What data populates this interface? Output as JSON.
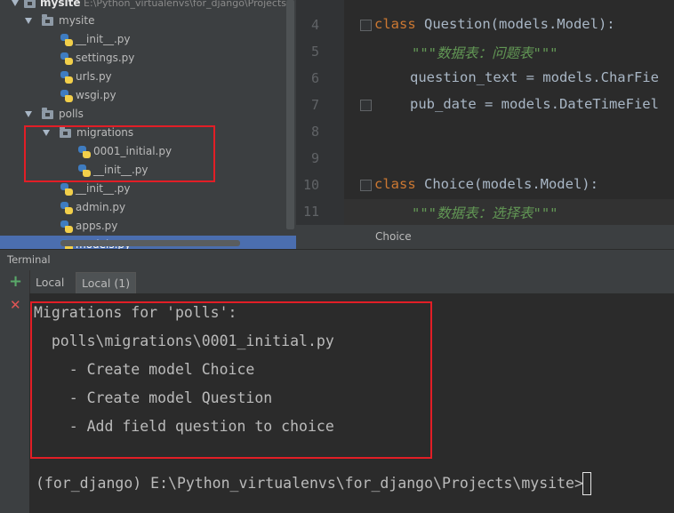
{
  "project_tree": {
    "items": [
      {
        "label": "mysite",
        "extra": "E:\\Python_virtualenvs\\for_django\\Projects",
        "kind": "folder",
        "expanded": true
      },
      {
        "label": "mysite",
        "kind": "folder",
        "expanded": true
      },
      {
        "label": "__init__.py",
        "kind": "file"
      },
      {
        "label": "settings.py",
        "kind": "file"
      },
      {
        "label": "urls.py",
        "kind": "file"
      },
      {
        "label": "wsgi.py",
        "kind": "file"
      },
      {
        "label": "polls",
        "kind": "folder",
        "expanded": true
      },
      {
        "label": "migrations",
        "kind": "folder",
        "expanded": true
      },
      {
        "label": "0001_initial.py",
        "kind": "file"
      },
      {
        "label": "__init__.py",
        "kind": "file"
      },
      {
        "label": "__init__.py",
        "kind": "file"
      },
      {
        "label": "admin.py",
        "kind": "file"
      },
      {
        "label": "apps.py",
        "kind": "file"
      },
      {
        "label": "models.py",
        "kind": "file",
        "selected": true
      }
    ]
  },
  "editor": {
    "lines": [
      {
        "num": "4",
        "kw": "class",
        "rest": " Question(models.Model):"
      },
      {
        "num": "5",
        "doc": "\"\"\"数据表：问题表\"\"\""
      },
      {
        "num": "6",
        "code": "question_text = models.CharFie"
      },
      {
        "num": "7",
        "code": "pub_date = models.DateTimeFiel"
      },
      {
        "num": "8"
      },
      {
        "num": "9"
      },
      {
        "num": "10",
        "kw": "class",
        "rest": " Choice(models.Model):"
      },
      {
        "num": "11",
        "doc": "\"\"\"数据表：选择表\"\"\""
      }
    ],
    "breadcrumb": "Choice"
  },
  "terminal": {
    "title": "Terminal",
    "tabs": [
      "Local",
      "Local (1)"
    ],
    "add_icon": "+",
    "close_icon": "✕",
    "output": [
      "Migrations for 'polls':",
      "  polls\\migrations\\0001_initial.py",
      "    - Create model Choice",
      "    - Create model Question",
      "    - Add field question to choice"
    ],
    "prompt": "(for_django) E:\\Python_virtualenvs\\for_django\\Projects\\mysite>"
  },
  "colors": {
    "highlight": "#e21e26",
    "keyword": "#cc7832",
    "docstring": "#629755",
    "selection": "#4b6eaf"
  }
}
